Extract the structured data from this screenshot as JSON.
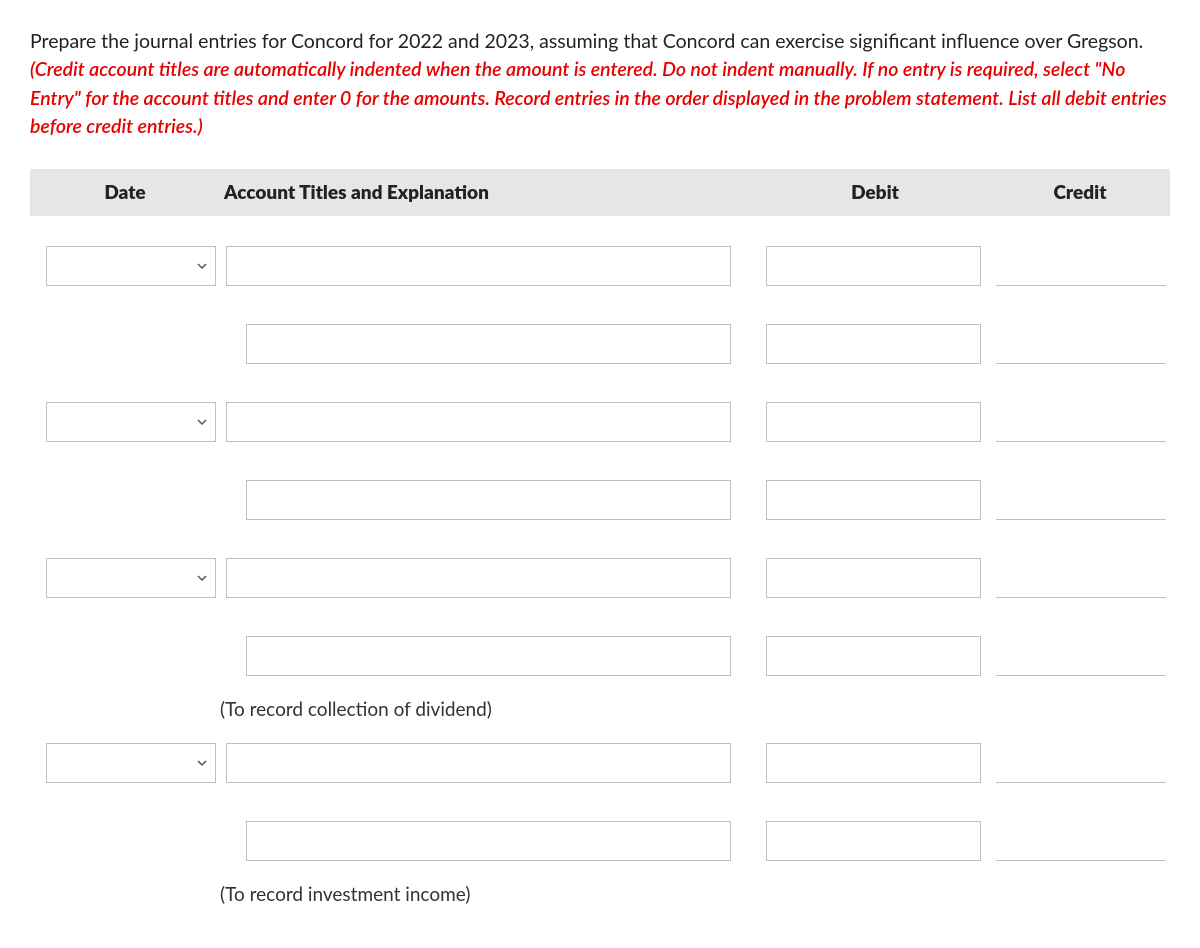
{
  "instructions": {
    "black": "Prepare the journal entries for Concord for 2022 and 2023, assuming that Concord can exercise significant influence over Gregson. ",
    "red": "(Credit account titles are automatically indented when the amount is entered. Do not indent manually. If no entry is required, select \"No Entry\" for the account titles and enter 0 for the amounts. Record entries in the order displayed in the problem statement. List all debit entries before credit entries.)"
  },
  "columns": {
    "date": "Date",
    "account": "Account Titles and Explanation",
    "debit": "Debit",
    "credit": "Credit"
  },
  "captions": {
    "dividend": "(To record collection of dividend)",
    "income": "(To record investment income)"
  }
}
